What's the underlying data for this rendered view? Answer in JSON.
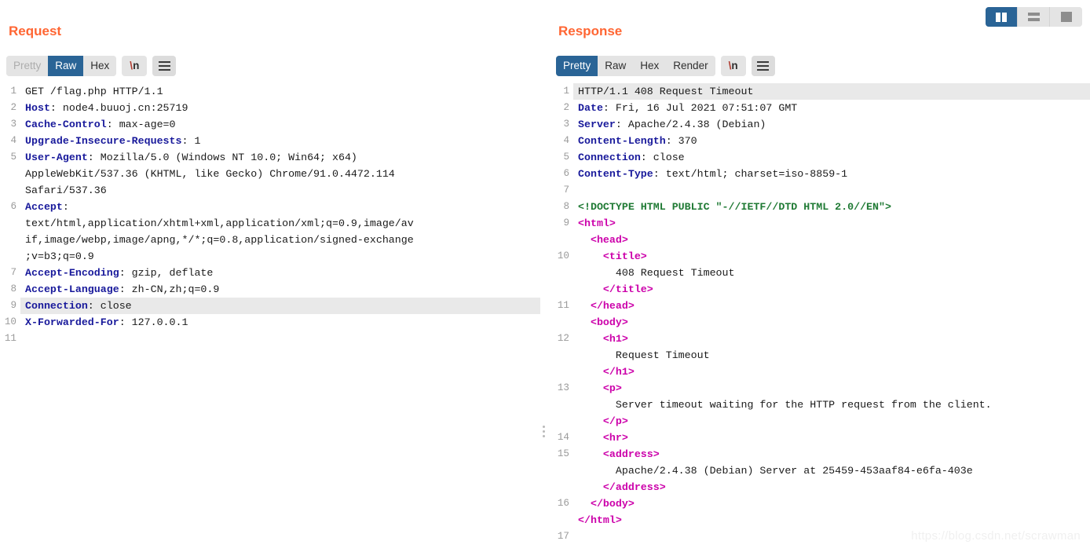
{
  "viewmodes": {
    "buttons": [
      {
        "name": "split-vertical",
        "active": true
      },
      {
        "name": "split-horizontal",
        "active": false
      },
      {
        "name": "single-pane",
        "active": false
      }
    ]
  },
  "request": {
    "title": "Request",
    "tabs": [
      {
        "label": "Pretty",
        "state": "disabled"
      },
      {
        "label": "Raw",
        "state": "active"
      },
      {
        "label": "Hex",
        "state": "normal"
      }
    ],
    "newline_label": "\\n",
    "menu_icon": "hamburger-icon",
    "lines": [
      {
        "num": "1",
        "hl": false,
        "segments": [
          {
            "t": "GET /flag.php HTTP/1.1",
            "c": "k-val"
          }
        ]
      },
      {
        "num": "2",
        "hl": false,
        "segments": [
          {
            "t": "Host",
            "c": "k-hdr"
          },
          {
            "t": ": node4.buuoj.cn:25719",
            "c": "k-val"
          }
        ]
      },
      {
        "num": "3",
        "hl": false,
        "segments": [
          {
            "t": "Cache-Control",
            "c": "k-hdr"
          },
          {
            "t": ": max-age=0",
            "c": "k-val"
          }
        ]
      },
      {
        "num": "4",
        "hl": false,
        "segments": [
          {
            "t": "Upgrade-Insecure-Requests",
            "c": "k-hdr"
          },
          {
            "t": ": 1",
            "c": "k-val"
          }
        ]
      },
      {
        "num": "5",
        "hl": false,
        "segments": [
          {
            "t": "User-Agent",
            "c": "k-hdr"
          },
          {
            "t": ": Mozilla/5.0 (Windows NT 10.0; Win64; x64)",
            "c": "k-val"
          }
        ]
      },
      {
        "num": "",
        "hl": false,
        "segments": [
          {
            "t": "AppleWebKit/537.36 (KHTML, like Gecko) Chrome/91.0.4472.114",
            "c": "k-val"
          }
        ]
      },
      {
        "num": "",
        "hl": false,
        "segments": [
          {
            "t": "Safari/537.36",
            "c": "k-val"
          }
        ]
      },
      {
        "num": "6",
        "hl": false,
        "segments": [
          {
            "t": "Accept",
            "c": "k-hdr"
          },
          {
            "t": ":",
            "c": "k-val"
          }
        ]
      },
      {
        "num": "",
        "hl": false,
        "segments": [
          {
            "t": "text/html,application/xhtml+xml,application/xml;q=0.9,image/av",
            "c": "k-val"
          }
        ]
      },
      {
        "num": "",
        "hl": false,
        "segments": [
          {
            "t": "if,image/webp,image/apng,*/*;q=0.8,application/signed-exchange",
            "c": "k-val"
          }
        ]
      },
      {
        "num": "",
        "hl": false,
        "segments": [
          {
            "t": ";v=b3;q=0.9",
            "c": "k-val"
          }
        ]
      },
      {
        "num": "7",
        "hl": false,
        "segments": [
          {
            "t": "Accept-Encoding",
            "c": "k-hdr"
          },
          {
            "t": ": gzip, deflate",
            "c": "k-val"
          }
        ]
      },
      {
        "num": "8",
        "hl": false,
        "segments": [
          {
            "t": "Accept-Language",
            "c": "k-hdr"
          },
          {
            "t": ": zh-CN,zh;q=0.9",
            "c": "k-val"
          }
        ]
      },
      {
        "num": "9",
        "hl": true,
        "segments": [
          {
            "t": "Connection",
            "c": "k-hdr"
          },
          {
            "t": ": close",
            "c": "k-val"
          }
        ]
      },
      {
        "num": "10",
        "hl": false,
        "segments": [
          {
            "t": "X-Forwarded-For",
            "c": "k-hdr"
          },
          {
            "t": ": 127.0.0.1",
            "c": "k-val"
          }
        ]
      },
      {
        "num": "11",
        "hl": false,
        "segments": []
      }
    ]
  },
  "response": {
    "title": "Response",
    "tabs": [
      {
        "label": "Pretty",
        "state": "active"
      },
      {
        "label": "Raw",
        "state": "normal"
      },
      {
        "label": "Hex",
        "state": "normal"
      },
      {
        "label": "Render",
        "state": "normal"
      }
    ],
    "newline_label": "\\n",
    "menu_icon": "hamburger-icon",
    "lines": [
      {
        "num": "1",
        "hl": true,
        "segments": [
          {
            "t": "HTTP/1.1 408 Request Timeout",
            "c": "k-val"
          }
        ]
      },
      {
        "num": "2",
        "hl": false,
        "segments": [
          {
            "t": "Date",
            "c": "k-hdr"
          },
          {
            "t": ": Fri, 16 Jul 2021 07:51:07 GMT",
            "c": "k-val"
          }
        ]
      },
      {
        "num": "3",
        "hl": false,
        "segments": [
          {
            "t": "Server",
            "c": "k-hdr"
          },
          {
            "t": ": Apache/2.4.38 (Debian)",
            "c": "k-val"
          }
        ]
      },
      {
        "num": "4",
        "hl": false,
        "segments": [
          {
            "t": "Content-Length",
            "c": "k-hdr"
          },
          {
            "t": ": 370",
            "c": "k-val"
          }
        ]
      },
      {
        "num": "5",
        "hl": false,
        "segments": [
          {
            "t": "Connection",
            "c": "k-hdr"
          },
          {
            "t": ": close",
            "c": "k-val"
          }
        ]
      },
      {
        "num": "6",
        "hl": false,
        "segments": [
          {
            "t": "Content-Type",
            "c": "k-hdr"
          },
          {
            "t": ": text/html; charset=iso-8859-1",
            "c": "k-val"
          }
        ]
      },
      {
        "num": "7",
        "hl": false,
        "segments": []
      },
      {
        "num": "8",
        "hl": false,
        "segments": [
          {
            "t": "<!DOCTYPE HTML PUBLIC \"-//IETF//DTD HTML 2.0//EN\">",
            "c": "k-doct"
          }
        ]
      },
      {
        "num": "9",
        "hl": false,
        "segments": [
          {
            "t": "<html>",
            "c": "k-tag"
          }
        ]
      },
      {
        "num": "",
        "hl": false,
        "segments": [
          {
            "t": "  <head>",
            "c": "k-tag"
          }
        ]
      },
      {
        "num": "10",
        "hl": false,
        "segments": [
          {
            "t": "    <title>",
            "c": "k-tag"
          }
        ]
      },
      {
        "num": "",
        "hl": false,
        "segments": [
          {
            "t": "      408 Request Timeout",
            "c": "k-text"
          }
        ]
      },
      {
        "num": "",
        "hl": false,
        "segments": [
          {
            "t": "    </title>",
            "c": "k-tag"
          }
        ]
      },
      {
        "num": "11",
        "hl": false,
        "segments": [
          {
            "t": "  </head>",
            "c": "k-tag"
          }
        ]
      },
      {
        "num": "",
        "hl": false,
        "segments": [
          {
            "t": "  <body>",
            "c": "k-tag"
          }
        ]
      },
      {
        "num": "12",
        "hl": false,
        "segments": [
          {
            "t": "    <h1>",
            "c": "k-tag"
          }
        ]
      },
      {
        "num": "",
        "hl": false,
        "segments": [
          {
            "t": "      Request Timeout",
            "c": "k-text"
          }
        ]
      },
      {
        "num": "",
        "hl": false,
        "segments": [
          {
            "t": "    </h1>",
            "c": "k-tag"
          }
        ]
      },
      {
        "num": "13",
        "hl": false,
        "segments": [
          {
            "t": "    <p>",
            "c": "k-tag"
          }
        ]
      },
      {
        "num": "",
        "hl": false,
        "segments": [
          {
            "t": "      Server timeout waiting for the HTTP request from the client.",
            "c": "k-text"
          }
        ]
      },
      {
        "num": "",
        "hl": false,
        "segments": [
          {
            "t": "    </p>",
            "c": "k-tag"
          }
        ]
      },
      {
        "num": "14",
        "hl": false,
        "segments": [
          {
            "t": "    <hr>",
            "c": "k-tag"
          }
        ]
      },
      {
        "num": "15",
        "hl": false,
        "segments": [
          {
            "t": "    <address>",
            "c": "k-tag"
          }
        ]
      },
      {
        "num": "",
        "hl": false,
        "segments": [
          {
            "t": "      Apache/2.4.38 (Debian) Server at 25459-453aaf84-e6fa-403e",
            "c": "k-text"
          }
        ]
      },
      {
        "num": "",
        "hl": false,
        "segments": [
          {
            "t": "    </address>",
            "c": "k-tag"
          }
        ]
      },
      {
        "num": "16",
        "hl": false,
        "segments": [
          {
            "t": "  </body>",
            "c": "k-tag"
          }
        ]
      },
      {
        "num": "",
        "hl": false,
        "segments": [
          {
            "t": "</html>",
            "c": "k-tag"
          }
        ]
      },
      {
        "num": "17",
        "hl": false,
        "segments": []
      }
    ]
  },
  "watermark": "https://blog.csdn.net/scrawman"
}
